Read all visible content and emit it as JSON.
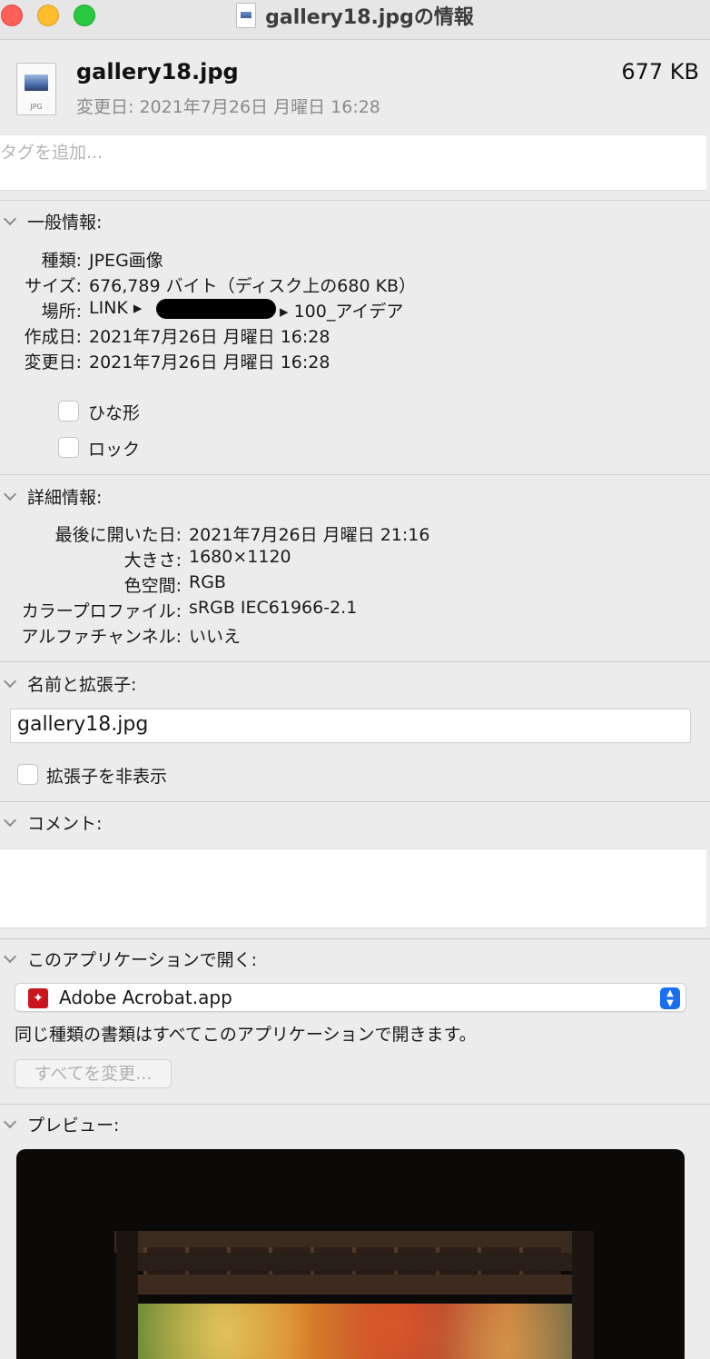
{
  "window": {
    "title": "gallery18.jpgの情報"
  },
  "file": {
    "name": "gallery18.jpg",
    "size": "677 KB",
    "modified": "変更日: 2021年7月26日 月曜日 16:28",
    "icon_label": "JPG"
  },
  "tags": {
    "placeholder": "タグを追加..."
  },
  "general": {
    "title": "一般情報:",
    "rows": [
      {
        "label": "種類:",
        "value": "JPEG画像"
      },
      {
        "label": "サイズ:",
        "value": "676,789 バイト（ディスク上の680 KB）"
      },
      {
        "label": "場所:",
        "value_prefix": "LINK ▸",
        "value_suffix": "▸ 100_アイデア"
      },
      {
        "label": "作成日:",
        "value": "2021年7月26日 月曜日 16:28"
      },
      {
        "label": "変更日:",
        "value": "2021年7月26日 月曜日 16:28"
      }
    ],
    "stationery_label": "ひな形",
    "locked_label": "ロック"
  },
  "more_info": {
    "title": "詳細情報:",
    "rows": [
      {
        "label": "最後に開いた日:",
        "value": "2021年7月26日 月曜日 21:16"
      },
      {
        "label": "大きさ:",
        "value": "1680×1120"
      },
      {
        "label": "色空間:",
        "value": "RGB"
      },
      {
        "label": "カラープロファイル:",
        "value": "sRGB IEC61966-2.1"
      },
      {
        "label": "アルファチャンネル:",
        "value": "いいえ"
      }
    ]
  },
  "name_ext": {
    "title": "名前と拡張子:",
    "value": "gallery18.jpg",
    "hide_ext_label": "拡張子を非表示"
  },
  "comments": {
    "title": "コメント:"
  },
  "open_with": {
    "title": "このアプリケーションで開く:",
    "app": "Adobe Acrobat.app",
    "note": "同じ種類の書類はすべてこのアプリケーションで開きます。",
    "change_all": "すべてを変更..."
  },
  "preview": {
    "title": "プレビュー:"
  }
}
